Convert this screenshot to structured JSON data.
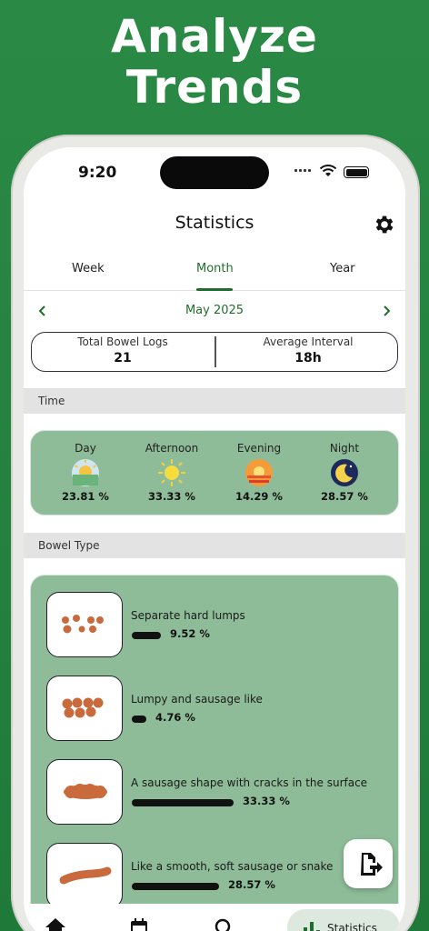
{
  "promo": {
    "line1": "Analyze",
    "line2": "Trends"
  },
  "status_bar": {
    "time": "9:20"
  },
  "header": {
    "title": "Statistics",
    "settings_icon": "gear-icon"
  },
  "tabs": [
    {
      "label": "Week",
      "active": false
    },
    {
      "label": "Month",
      "active": true
    },
    {
      "label": "Year",
      "active": false
    }
  ],
  "period_nav": {
    "label": "May 2025",
    "prev_icon": "chevron-left-icon",
    "next_icon": "chevron-right-icon"
  },
  "summary": {
    "total_label": "Total Bowel Logs",
    "total_value": "21",
    "interval_label": "Average Interval",
    "interval_value": "18h"
  },
  "time_section": {
    "title": "Time",
    "periods": [
      {
        "name": "Day",
        "pct": "23.81 %",
        "icon": "sunrise-icon"
      },
      {
        "name": "Afternoon",
        "pct": "33.33 %",
        "icon": "sun-icon"
      },
      {
        "name": "Evening",
        "pct": "14.29 %",
        "icon": "sunset-icon"
      },
      {
        "name": "Night",
        "pct": "28.57 %",
        "icon": "moon-icon"
      }
    ]
  },
  "bowel_section": {
    "title": "Bowel Type",
    "types": [
      {
        "desc": "Separate hard lumps",
        "pct": "9.52 %",
        "fraction": 0.0952
      },
      {
        "desc": "Lumpy and sausage like",
        "pct": "4.76 %",
        "fraction": 0.0476
      },
      {
        "desc": "A sausage shape with cracks in the surface",
        "pct": "33.33 %",
        "fraction": 0.3333
      },
      {
        "desc": "Like a smooth, soft sausage or snake",
        "pct": "28.57 %",
        "fraction": 0.2857
      }
    ]
  },
  "fab": {
    "icon": "export-icon"
  },
  "bottom_nav": {
    "items": [
      {
        "icon": "home-icon"
      },
      {
        "icon": "calendar-icon"
      },
      {
        "icon": "search-icon"
      },
      {
        "icon": "chart-icon",
        "label": "Statistics",
        "active": true
      }
    ]
  },
  "colors": {
    "accent": "#1f6e2d",
    "card": "#8ebc98",
    "background": "#258440",
    "stool": "#c86a3c"
  }
}
